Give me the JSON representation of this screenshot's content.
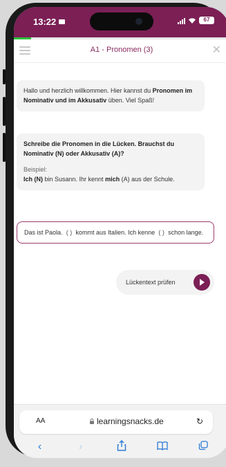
{
  "status": {
    "time": "13:22",
    "battery": "67"
  },
  "progress": {
    "fraction": 0.08
  },
  "header": {
    "title": "A1 - Pronomen (3)"
  },
  "messages": {
    "welcome": {
      "part1": "Hallo und herzlich willkommen. Hier kannst du",
      "bold": "Pronomen im Nominativ und im Akkusativ",
      "part2": " üben. Viel Spaß!"
    },
    "task": {
      "instruction": "Schreibe die Pronomen in die Lücken. Brauchst du Nominativ (N) oder Akkusativ (A)?",
      "example_label": "Beispiel:",
      "ex_w1": "Ich (N)",
      "ex_t1": " bin Susann. Ihr kennt ",
      "ex_w2": "mich",
      "ex_t2": " (A) aus der Schule."
    },
    "cloze": {
      "t1": "Das ist Paola.",
      "gap1": "(   )",
      "t2": " kommt aus Italien. Ich kenne ",
      "gap2": "(   )",
      "t3": " schon lange."
    }
  },
  "check_button": {
    "label": "Lückentext prüfen"
  },
  "browser": {
    "aa": "AA",
    "url": "learningsnacks.de"
  }
}
